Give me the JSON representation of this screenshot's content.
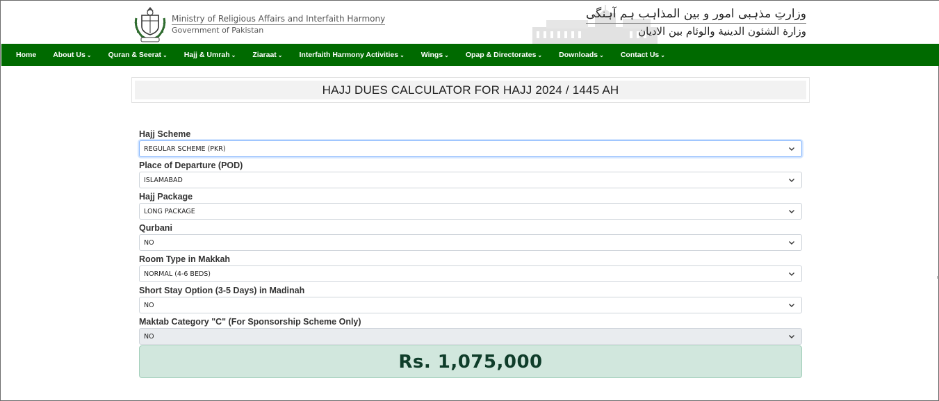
{
  "header": {
    "ministry_en": "Ministry of Religious Affairs and Interfaith Harmony",
    "government_en": "Government of Pakistan",
    "ministry_urdu": "وزارتِ مذہبی امور و بین المذاہب ہم آہنگی",
    "ministry_arabic": "وزارة الشئون الدينية والوئام بين الاديان"
  },
  "nav": {
    "items": [
      {
        "label": "Home",
        "dropdown": false
      },
      {
        "label": "About Us",
        "dropdown": true
      },
      {
        "label": "Quran & Seerat",
        "dropdown": true
      },
      {
        "label": "Hajj & Umrah",
        "dropdown": true
      },
      {
        "label": "Ziaraat",
        "dropdown": true
      },
      {
        "label": "Interfaith Harmony Activities",
        "dropdown": true
      },
      {
        "label": "Wings",
        "dropdown": true
      },
      {
        "label": "Opap & Directorates",
        "dropdown": true
      },
      {
        "label": "Downloads",
        "dropdown": true
      },
      {
        "label": "Contact Us",
        "dropdown": true
      }
    ],
    "color": "#006a00"
  },
  "page_title": "HAJJ DUES CALCULATOR FOR HAJJ 2024 / 1445 AH",
  "form": {
    "fields": [
      {
        "label": "Hajj Scheme",
        "value": "REGULAR SCHEME (PKR)"
      },
      {
        "label": "Place of Departure (POD)",
        "value": "ISLAMABAD"
      },
      {
        "label": "Hajj Package",
        "value": "LONG PACKAGE"
      },
      {
        "label": "Qurbani",
        "value": "NO"
      },
      {
        "label": "Room Type in Makkah",
        "value": "NORMAL (4-6 BEDS)"
      },
      {
        "label": "Short Stay Option (3-5 Days) in Madinah",
        "value": "NO"
      },
      {
        "label": "Maktab Category \"C\" (For Sponsorship Scheme Only)",
        "value": "NO"
      }
    ]
  },
  "total": {
    "amount": "Rs. 1,075,000",
    "color": "#d1e7dd"
  }
}
